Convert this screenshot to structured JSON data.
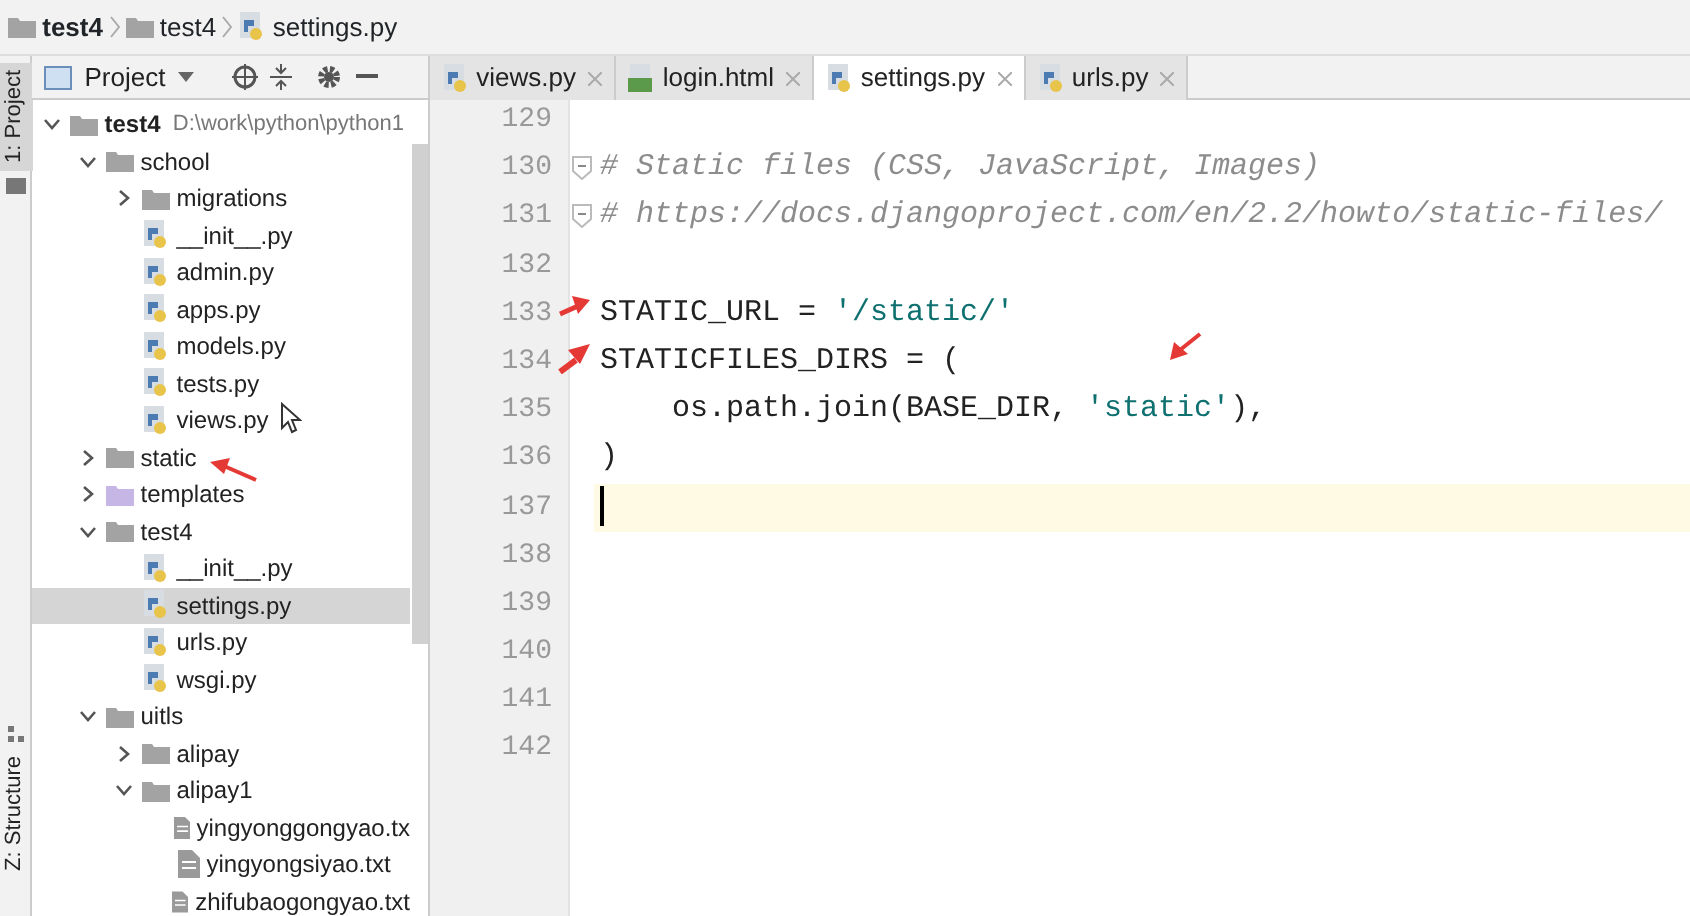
{
  "breadcrumb": [
    {
      "label": "test4",
      "kind": "folder",
      "bold": true
    },
    {
      "label": "test4",
      "kind": "folder",
      "bold": false
    },
    {
      "label": "settings.py",
      "kind": "py",
      "bold": false
    }
  ],
  "tool_windows": [
    {
      "label": "1: Project",
      "selected": true
    },
    {
      "label": "Z: Structure",
      "selected": false
    }
  ],
  "project_panel": {
    "title": "Project",
    "tree": [
      {
        "label": "test4",
        "path": "D:\\work\\python\\python1",
        "kind": "folder",
        "expanded": true,
        "selected": false,
        "children": [
          {
            "label": "school",
            "kind": "folder",
            "expanded": true,
            "selected": false,
            "children": [
              {
                "label": "migrations",
                "kind": "folder",
                "expanded": false,
                "selected": false
              },
              {
                "label": "__init__.py",
                "kind": "py",
                "selected": false
              },
              {
                "label": "admin.py",
                "kind": "py",
                "selected": false
              },
              {
                "label": "apps.py",
                "kind": "py",
                "selected": false
              },
              {
                "label": "models.py",
                "kind": "py",
                "selected": false
              },
              {
                "label": "tests.py",
                "kind": "py",
                "selected": false
              },
              {
                "label": "views.py",
                "kind": "py",
                "selected": false
              }
            ]
          },
          {
            "label": "static",
            "kind": "folder",
            "expanded": false,
            "selected": false
          },
          {
            "label": "templates",
            "kind": "template_folder",
            "expanded": false,
            "selected": false
          },
          {
            "label": "test4",
            "kind": "folder",
            "expanded": true,
            "selected": false,
            "children": [
              {
                "label": "__init__.py",
                "kind": "py",
                "selected": false
              },
              {
                "label": "settings.py",
                "kind": "py",
                "selected": true
              },
              {
                "label": "urls.py",
                "kind": "py",
                "selected": false
              },
              {
                "label": "wsgi.py",
                "kind": "py",
                "selected": false
              }
            ]
          },
          {
            "label": "uitls",
            "kind": "folder",
            "expanded": true,
            "selected": false,
            "children": [
              {
                "label": "alipay",
                "kind": "folder",
                "expanded": false,
                "selected": false
              },
              {
                "label": "alipay1",
                "kind": "folder",
                "expanded": true,
                "selected": false,
                "children": [
                  {
                    "label": "yingyonggongyao.tx",
                    "kind": "txt",
                    "selected": false
                  },
                  {
                    "label": "yingyongsiyao.txt",
                    "kind": "txt",
                    "selected": false
                  },
                  {
                    "label": "zhifubaogongyao.txt",
                    "kind": "txt",
                    "selected": false
                  }
                ]
              }
            ]
          }
        ]
      }
    ]
  },
  "tabs": [
    {
      "label": "views.py",
      "kind": "py",
      "selected": false
    },
    {
      "label": "login.html",
      "kind": "html",
      "selected": false
    },
    {
      "label": "settings.py",
      "kind": "py",
      "selected": true
    },
    {
      "label": "urls.py",
      "kind": "py",
      "selected": false
    }
  ],
  "editor": {
    "lines": [
      {
        "number": "129",
        "fold": false,
        "current": false
      },
      {
        "number": "130",
        "fold": true,
        "current": false,
        "tokens": [
          {
            "kind": "comment",
            "text": "# Static files (CSS, JavaScript, Images)"
          }
        ]
      },
      {
        "number": "131",
        "fold": true,
        "current": false,
        "tokens": [
          {
            "kind": "comment",
            "text": "# https://docs.djangoproject.com/en/2.2/howto/static-files/"
          }
        ]
      },
      {
        "number": "132",
        "fold": false,
        "current": false
      },
      {
        "number": "133",
        "fold": false,
        "current": false,
        "tokens": [
          {
            "kind": "plain",
            "text": "STATIC_URL = "
          },
          {
            "kind": "string",
            "text": "'/static/'"
          }
        ]
      },
      {
        "number": "134",
        "fold": false,
        "current": false,
        "tokens": [
          {
            "kind": "plain",
            "text": "STATICFILES_DIRS = ("
          }
        ]
      },
      {
        "number": "135",
        "fold": false,
        "current": false,
        "tokens": [
          {
            "kind": "plain",
            "text": "    os.path.join(BASE_DIR, "
          },
          {
            "kind": "string",
            "text": "'static'"
          },
          {
            "kind": "plain",
            "text": "),"
          }
        ]
      },
      {
        "number": "136",
        "fold": false,
        "current": false,
        "tokens": [
          {
            "kind": "plain",
            "text": ")"
          }
        ]
      },
      {
        "number": "137",
        "fold": false,
        "current": true
      },
      {
        "number": "138",
        "fold": false,
        "current": false
      },
      {
        "number": "139",
        "fold": false,
        "current": false
      },
      {
        "number": "140",
        "fold": false,
        "current": false
      },
      {
        "number": "141",
        "fold": false,
        "current": false
      },
      {
        "number": "142",
        "fold": false,
        "current": false
      }
    ]
  }
}
